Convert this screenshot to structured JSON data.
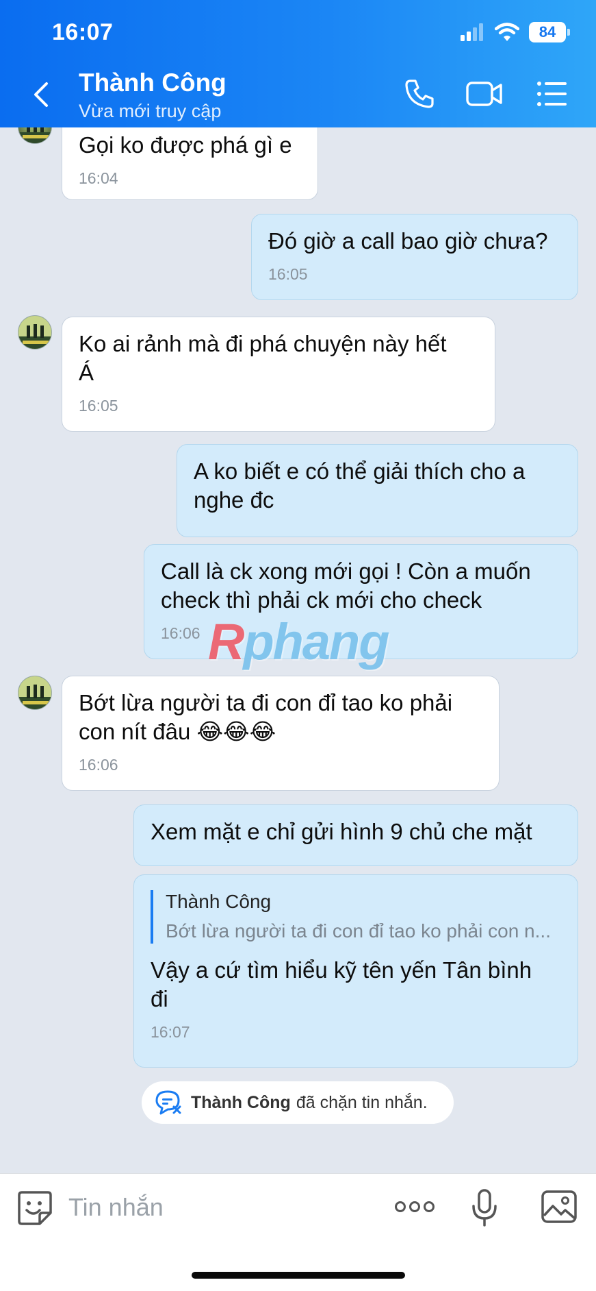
{
  "status_bar": {
    "time": "16:07",
    "battery": "84"
  },
  "header": {
    "contact_name": "Thành Công",
    "contact_status": "Vừa mới truy cập",
    "icons": [
      "back-icon",
      "phone-icon",
      "video-icon",
      "menu-icon"
    ]
  },
  "messages": [
    {
      "side": "in",
      "text": "Gọi ko được phá gì e",
      "time": "16:04"
    },
    {
      "side": "out",
      "text": "Đó giờ a call bao giờ chưa?",
      "time": "16:05"
    },
    {
      "side": "in",
      "line1": "Ko ai rảnh mà đi phá chuyện này hết",
      "line2": "Á",
      "time": "16:05"
    },
    {
      "side": "out",
      "line1": "A ko biết e có thể giải thích cho a",
      "line2": "nghe đc"
    },
    {
      "side": "out",
      "line1": "Call là ck xong mới gọi ! Còn a muốn",
      "line2": "check thì phải ck mới cho check",
      "time": "16:06"
    },
    {
      "side": "in",
      "line1": "Bớt lừa người ta đi con đỉ tao ko phải",
      "line2": "con nít đâu 😂😂😂",
      "time": "16:06"
    },
    {
      "side": "out",
      "text": "Xem mặt e chỉ gửi hình 9 chủ che mặt"
    },
    {
      "side": "out",
      "quote_name": "Thành Công",
      "quote_text": "Bớt lừa người ta đi con đỉ tao ko phải con n...",
      "line1": "Vậy a cứ tìm hiểu kỹ tên yến Tân bình",
      "line2": "đi",
      "time": "16:07"
    }
  ],
  "notice": {
    "name": "Thành Công",
    "text": "đã chặn tin nhắn."
  },
  "watermark": {
    "first": "R",
    "rest": "phang"
  },
  "input_bar": {
    "placeholder": "Tin nhắn",
    "icons": [
      "sticker-icon",
      "more-icon",
      "microphone-icon",
      "image-icon"
    ]
  },
  "colors": {
    "header_start": "#0a6df0",
    "header_end": "#2fa6f8",
    "outgoing_bubble": "#d3ebfb",
    "incoming_bubble": "#ffffff",
    "chat_bg": "#e2e7ef"
  }
}
